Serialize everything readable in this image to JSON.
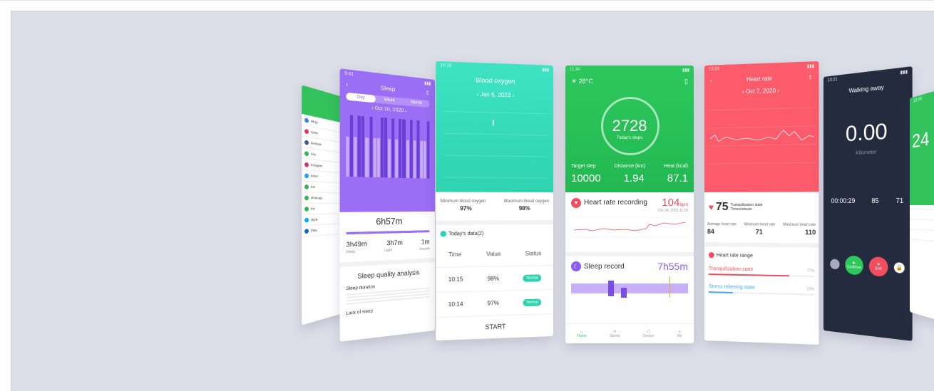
{
  "p1": {
    "items": [
      "wingu",
      "callee",
      "facebook",
      "Line",
      "Instagram",
      "twitter",
      "line",
      "whatsapp",
      "line",
      "skype",
      "Zhihu"
    ],
    "colors": [
      "#3c82e6",
      "#e8345a",
      "#3b5998",
      "#2fb84f",
      "#c9337d",
      "#1da1f2",
      "#2fb84f",
      "#2fb84f",
      "#2fb84f",
      "#00aff0",
      "#0a66c2"
    ]
  },
  "p2": {
    "title": "Sleep",
    "tabs": [
      "Day",
      "Week",
      "Month"
    ],
    "date": "Oct 10, 2020",
    "total": "6h57m",
    "deep": "3h49m",
    "light": "3h7m",
    "awake": "1m",
    "deep_label": "Deep",
    "light_label": "Light",
    "awake_label": "Awake",
    "section": "Sleep quality analysis",
    "sub1": "Sleep duration",
    "sub2": "Lack of sleep"
  },
  "p3": {
    "title": "Blood oxygen",
    "date": "Jan 6, 2023",
    "min_label": "Minimum blood oxygen",
    "max_label": "Maximum blood oxygen",
    "min": "97%",
    "max": "98%",
    "today": "Today's data(2)",
    "cols": [
      "Time",
      "Value",
      "Status"
    ],
    "rows": [
      [
        "10:15",
        "98%",
        "Normal"
      ],
      [
        "10:14",
        "97%",
        "Normal"
      ]
    ],
    "start": "START"
  },
  "p4": {
    "time": "11:30",
    "weather": "28°C",
    "steps": "2728",
    "steps_label": "Today's steps",
    "target_label": "Target step",
    "target": "10000",
    "distance_label": "Distance (km)",
    "distance": "1.94",
    "heat_label": "Heat (kcal)",
    "heat": "87.1",
    "hr_title": "Heart rate recording",
    "hr_value": "104",
    "hr_unit": "bpm",
    "hr_date": "Oct 24, 2023 11:20",
    "sleep_title": "Sleep record",
    "sleep_value": "7h55m",
    "nav": [
      "Home",
      "Sports",
      "Device",
      "Me"
    ]
  },
  "p5": {
    "title": "Heart rate",
    "date": "Oct 7, 2020",
    "value": "75",
    "state": "Tranquilization state",
    "unit": "Times/minute",
    "avg_label": "Average heart rate",
    "min_label": "Minimum heart rate",
    "max_label": "Maximum heart rate",
    "avg": "84",
    "min": "71",
    "max": "110",
    "range_title": "Heart rate range",
    "r1": "Tranquilization state",
    "r1p": "77%",
    "r2": "Stress relieving state",
    "r2p": "23%"
  },
  "p6": {
    "title": "Walking away",
    "distance": "0.00",
    "unit": "Kilometer",
    "time": "00:00:29",
    "pace": "85",
    "steps": "71",
    "continue": "Continue",
    "end": "End"
  },
  "p7": {
    "big": "24"
  }
}
